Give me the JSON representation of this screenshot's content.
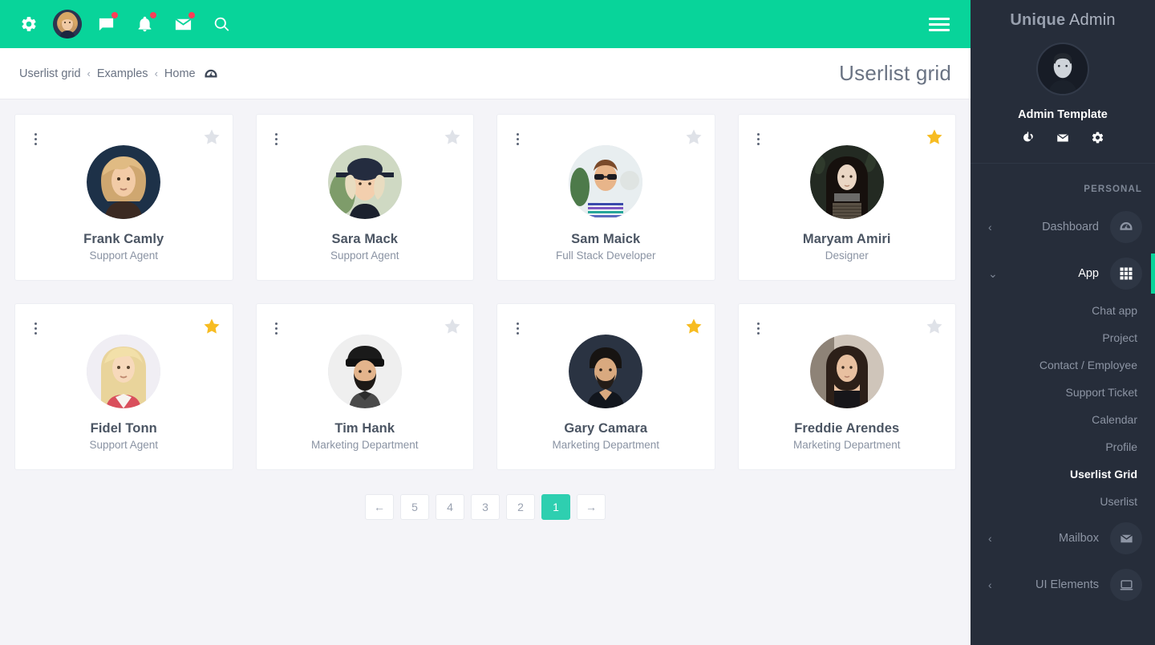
{
  "topbar": {
    "bg": "#08d49a",
    "items": [
      {
        "name": "gear-icon",
        "badge": false
      },
      {
        "name": "user-avatar",
        "badge": false
      },
      {
        "name": "chat-icon",
        "badge": true
      },
      {
        "name": "bell-icon",
        "badge": true
      },
      {
        "name": "mail-icon",
        "badge": true
      },
      {
        "name": "search-icon",
        "badge": false
      }
    ],
    "menu_icon": "hamburger-icon"
  },
  "breadcrumb": {
    "items": [
      "Userlist grid",
      "Examples",
      "Home"
    ],
    "separator": "‹",
    "home_icon": "dashboard-icon"
  },
  "page": {
    "title": "Userlist grid"
  },
  "cards": [
    {
      "name": "Frank Camly",
      "role": "Support Agent",
      "starred": false,
      "avatar": "woman-blonde-curly"
    },
    {
      "name": "Sara Mack",
      "role": "Support Agent",
      "starred": false,
      "avatar": "woman-hat"
    },
    {
      "name": "Sam Maick",
      "role": "Full Stack Developer",
      "starred": false,
      "avatar": "man-sunglasses"
    },
    {
      "name": "Maryam Amiri",
      "role": "Designer",
      "starred": true,
      "avatar": "woman-dark-hair"
    },
    {
      "name": "Fidel Tonn",
      "role": "Support Agent",
      "starred": true,
      "avatar": "woman-blonde"
    },
    {
      "name": "Tim Hank",
      "role": "Marketing Department",
      "starred": false,
      "avatar": "man-beanie-beard"
    },
    {
      "name": "Gary Camara",
      "role": "Marketing Department",
      "starred": true,
      "avatar": "man-dark-hair"
    },
    {
      "name": "Freddie Arendes",
      "role": "Marketing Department",
      "starred": false,
      "avatar": "woman-brunette"
    }
  ],
  "pagination": {
    "prev_label": "←",
    "next_label": "→",
    "pages": [
      "5",
      "4",
      "3",
      "2",
      "1"
    ],
    "active": "1"
  },
  "sidebar": {
    "logo_bold": "Unique",
    "logo_rest": " Admin",
    "profile_name": "Admin Template",
    "profile_actions": [
      "power-icon",
      "mail-icon",
      "gear-icon"
    ],
    "section_label": "PERSONAL",
    "items": [
      {
        "label": "Dashboard",
        "icon": "speedometer-icon",
        "chevron": "‹",
        "active": false
      },
      {
        "label": "App",
        "icon": "grid-icon",
        "chevron": "⌄",
        "active": true
      },
      {
        "label": "Mailbox",
        "icon": "envelope-icon",
        "chevron": "‹",
        "active": false
      },
      {
        "label": "UI Elements",
        "icon": "laptop-icon",
        "chevron": "‹",
        "active": false
      }
    ],
    "submenu": [
      {
        "label": "Chat app",
        "active": false
      },
      {
        "label": "Project",
        "active": false
      },
      {
        "label": "Contact / Employee",
        "active": false
      },
      {
        "label": "Support Ticket",
        "active": false
      },
      {
        "label": "Calendar",
        "active": false
      },
      {
        "label": "Profile",
        "active": false
      },
      {
        "label": "Userlist Grid",
        "active": true
      },
      {
        "label": "Userlist",
        "active": false
      }
    ]
  },
  "colors": {
    "accent_teal": "#08d49a",
    "pager_active": "#2ecfb0",
    "star_gold": "#f7bc22",
    "star_grey": "#dfe2e8",
    "sidebar_bg": "#262d3a",
    "page_bg": "#f4f4f8",
    "badge_red": "#ff3d57"
  }
}
